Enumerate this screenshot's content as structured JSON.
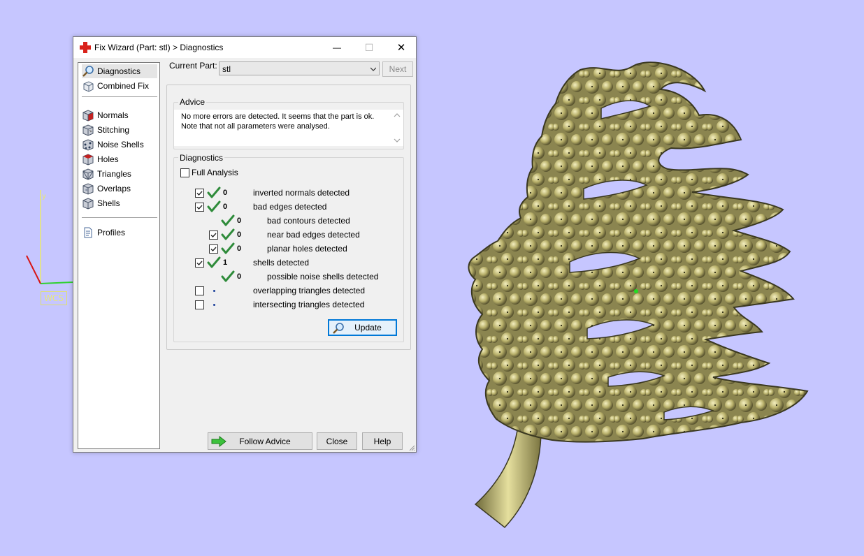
{
  "window": {
    "title": "Fix Wizard (Part: stl) > Diagnostics",
    "controls": {
      "minimize": "—",
      "maximize": "☐",
      "close": "✕"
    }
  },
  "viewport": {
    "axis_label": "WCS",
    "background": "#c6c6ff",
    "model_color": "#c9c17a"
  },
  "sidebar": {
    "items": [
      {
        "label": "Diagnostics",
        "icon": "magnifier-icon",
        "active": true
      },
      {
        "label": "Combined Fix",
        "icon": "cube-icon"
      },
      {
        "label": "Normals",
        "icon": "normals-cube-icon"
      },
      {
        "label": "Stitching",
        "icon": "stitching-cube-icon"
      },
      {
        "label": "Noise Shells",
        "icon": "noise-shells-icon"
      },
      {
        "label": "Holes",
        "icon": "holes-cube-icon"
      },
      {
        "label": "Triangles",
        "icon": "triangles-cube-icon"
      },
      {
        "label": "Overlaps",
        "icon": "overlaps-cube-icon"
      },
      {
        "label": "Shells",
        "icon": "shells-cube-icon"
      },
      {
        "label": "Profiles",
        "icon": "document-icon"
      }
    ]
  },
  "part": {
    "label": "Current Part:",
    "value": "stl",
    "next_label": "Next"
  },
  "advice": {
    "title": "Advice",
    "line1": "No more errors are detected. It seems that the part is ok.",
    "line2": "Note that not all parameters were analysed."
  },
  "diagnostics": {
    "title": "Diagnostics",
    "full_analysis_label": "Full Analysis",
    "full_analysis_checked": false,
    "rows": [
      {
        "checked": true,
        "status": "ok",
        "count": "0",
        "label": "inverted normals detected"
      },
      {
        "checked": true,
        "status": "ok",
        "count": "0",
        "label": "bad edges detected"
      },
      {
        "checked": null,
        "status": "ok",
        "count": "0",
        "label": "bad contours detected"
      },
      {
        "checked": true,
        "status": "ok",
        "count": "0",
        "label": "near bad edges detected"
      },
      {
        "checked": true,
        "status": "ok",
        "count": "0",
        "label": "planar holes detected"
      },
      {
        "checked": true,
        "status": "ok",
        "count": "1",
        "label": "shells detected"
      },
      {
        "checked": null,
        "status": "ok",
        "count": "0",
        "label": "possible noise shells detected"
      },
      {
        "checked": false,
        "status": "pending",
        "count": "",
        "label": "overlapping triangles detected"
      },
      {
        "checked": false,
        "status": "pending",
        "count": "",
        "label": "intersecting triangles detected"
      }
    ],
    "update_label": "Update"
  },
  "footer": {
    "follow_advice_label": "Follow Advice",
    "close_label": "Close",
    "help_label": "Help"
  },
  "colors": {
    "tick_green": "#2e8b3a",
    "focus_blue": "#0078d7",
    "accent_red": "#d9221b"
  }
}
